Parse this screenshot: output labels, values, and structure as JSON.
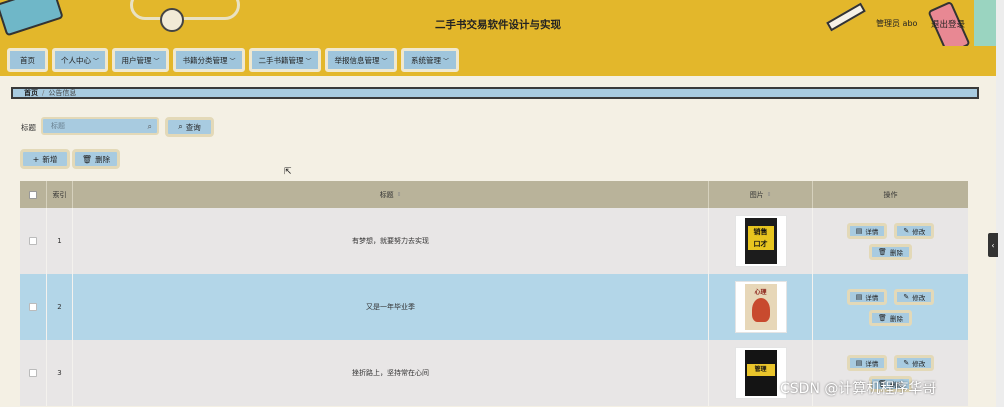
{
  "header": {
    "title": "二手书交易软件设计与实现",
    "admin": "管理员 abo",
    "logout": "退出登录"
  },
  "nav": [
    {
      "label": "首页",
      "dropdown": false
    },
    {
      "label": "个人中心",
      "dropdown": true
    },
    {
      "label": "用户管理",
      "dropdown": true
    },
    {
      "label": "书籍分类管理",
      "dropdown": true
    },
    {
      "label": "二手书籍管理",
      "dropdown": true
    },
    {
      "label": "举报信息管理",
      "dropdown": true
    },
    {
      "label": "系统管理",
      "dropdown": true
    }
  ],
  "breadcrumb": {
    "home": "首页",
    "separator": "/",
    "current": "公告信息"
  },
  "search": {
    "label": "标题",
    "placeholder": "标题",
    "button": "查询"
  },
  "toolbar": {
    "add": "新增",
    "delete": "删除"
  },
  "table": {
    "headers": {
      "index": "索引",
      "title": "标题",
      "image": "图片",
      "actions": "操作"
    },
    "rows": [
      {
        "index": "1",
        "title": "有梦想，就要努力去实现",
        "cover_text": [
          "销售",
          "口才"
        ],
        "selected": false
      },
      {
        "index": "2",
        "title": "又是一年毕业季",
        "cover_text": [
          "心理"
        ],
        "selected": true
      },
      {
        "index": "3",
        "title": "挫折路上，坚持常在心间",
        "cover_text": [
          "管理"
        ],
        "selected": false
      }
    ],
    "actions": {
      "detail": "详情",
      "edit": "修改",
      "delete": "删除"
    }
  },
  "watermark": "CSDN @计算机程序华哥",
  "colors": {
    "header": "#e3b72b",
    "button": "#a8cbe0",
    "table_header": "#b9b39a",
    "selected_row": "#b3d6e8"
  }
}
